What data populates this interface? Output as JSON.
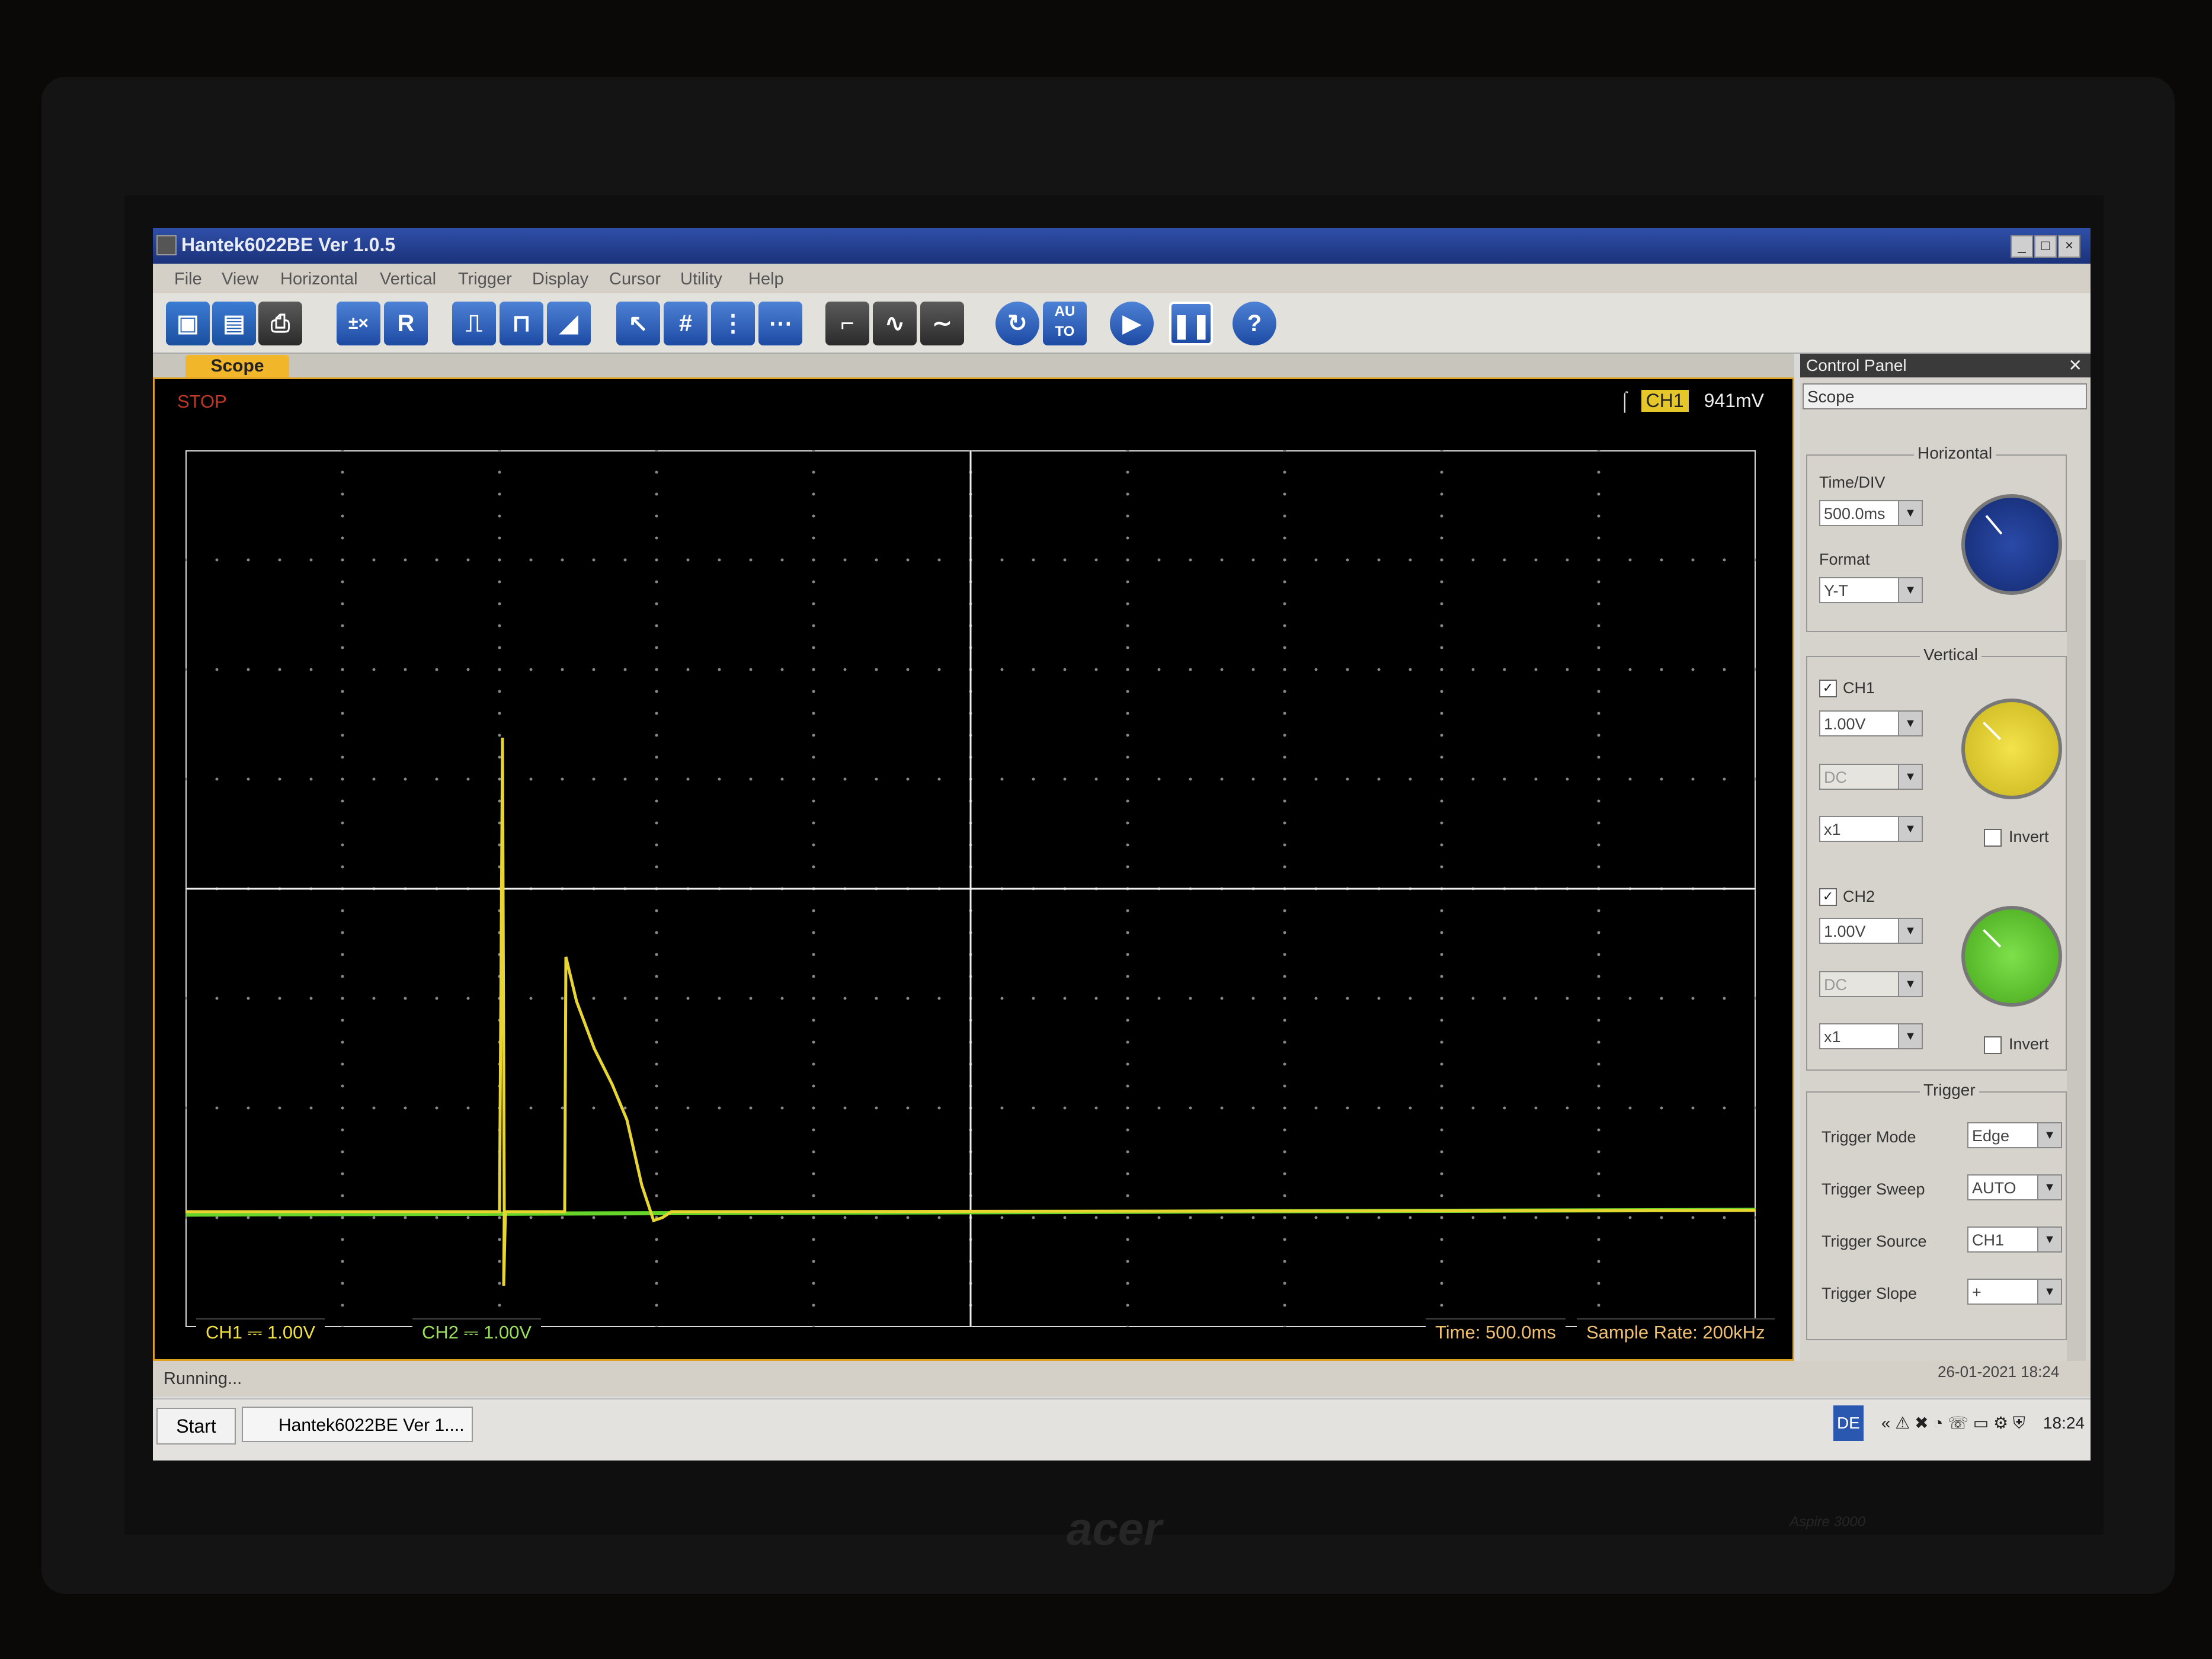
{
  "window": {
    "title": "Hantek6022BE Ver 1.0.5"
  },
  "menu": [
    "File",
    "View",
    "Horizontal",
    "Vertical",
    "Trigger",
    "Display",
    "Cursor",
    "Utility",
    "Help"
  ],
  "toolbar": {
    "record_label": "R",
    "auto_label": "AU\nTO",
    "help_label": "?"
  },
  "tab": {
    "label": "Scope"
  },
  "scope": {
    "status": "STOP",
    "trigger_channel": "CH1",
    "trigger_level": "941mV",
    "ch1_label": "CH1 ⎓  1.00V",
    "ch2_label": "CH2 ⎓  1.00V",
    "time_label": "Time: 500.0ms",
    "sample_rate_label": "Sample Rate: 200kHz"
  },
  "control_panel": {
    "header": "Control Panel",
    "mode": "Scope",
    "horizontal": {
      "title": "Horizontal",
      "time_div_label": "Time/DIV",
      "time_div": "500.0ms",
      "format_label": "Format",
      "format": "Y-T"
    },
    "vertical": {
      "title": "Vertical",
      "ch1": {
        "name": "CH1",
        "enabled": true,
        "volts": "1.00V",
        "coupling": "DC",
        "probe": "x1",
        "invert_label": "Invert",
        "color": "#e8d530"
      },
      "ch2": {
        "name": "CH2",
        "enabled": true,
        "volts": "1.00V",
        "coupling": "DC",
        "probe": "x1",
        "invert_label": "Invert",
        "color": "#66d42a"
      }
    },
    "trigger": {
      "title": "Trigger",
      "mode_label": "Trigger Mode",
      "mode": "Edge",
      "sweep_label": "Trigger Sweep",
      "sweep": "AUTO",
      "source_label": "Trigger Source",
      "source": "CH1",
      "slope_label": "Trigger Slope",
      "slope": "+"
    }
  },
  "statusbar": {
    "text": "Running..."
  },
  "taskbar": {
    "start": "Start",
    "item": "Hantek6022BE Ver 1....",
    "lang": "DE",
    "clock": "18:24"
  },
  "datestamp": "26-01-2021  18:24",
  "bezel": {
    "brand": "acer",
    "model": "Aspire 3000"
  },
  "icons": [
    "save-icon",
    "print-icon",
    "play-icon",
    "pause-icon",
    "help-icon",
    "cursor-icon"
  ]
}
